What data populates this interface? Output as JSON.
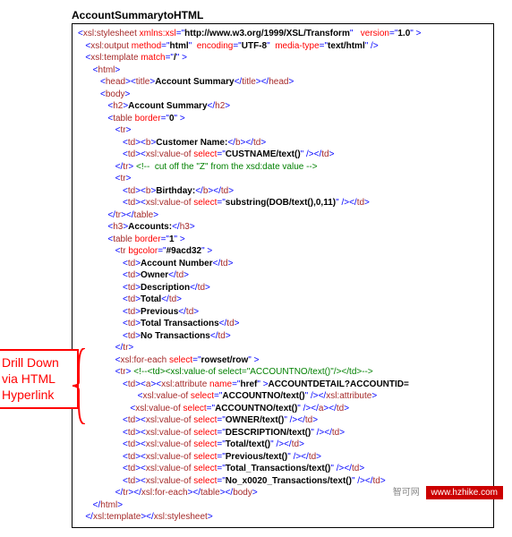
{
  "title": "AccountSummarytoHTML",
  "annotation": "Drill Down via HTML Hyperlink",
  "watermark": {
    "cn": "智可网",
    "url": "www.hzhike.com"
  },
  "tokens": {
    "l01": [
      [
        "<",
        "t-blue"
      ],
      [
        "xsl:stylesheet",
        "t-brown"
      ],
      [
        " xmlns:xsl",
        "t-red"
      ],
      [
        "=\"",
        "t-blue"
      ],
      [
        "http://www.w3.org/1999/XSL/Transform",
        "t-black"
      ],
      [
        "\"   ",
        "t-blue"
      ],
      [
        "version",
        "t-red"
      ],
      [
        "=\"",
        "t-blue"
      ],
      [
        "1.0",
        "t-black"
      ],
      [
        "\" >",
        "t-blue"
      ]
    ],
    "l02": [
      [
        "   <",
        "t-blue"
      ],
      [
        "xsl:output",
        "t-brown"
      ],
      [
        " method",
        "t-red"
      ],
      [
        "=\"",
        "t-blue"
      ],
      [
        "html",
        "t-black"
      ],
      [
        "\"  ",
        "t-blue"
      ],
      [
        "encoding",
        "t-red"
      ],
      [
        "=\"",
        "t-blue"
      ],
      [
        "UTF-8",
        "t-black"
      ],
      [
        "\"  ",
        "t-blue"
      ],
      [
        "media-type",
        "t-red"
      ],
      [
        "=\"",
        "t-blue"
      ],
      [
        "text/html",
        "t-black"
      ],
      [
        "\" />",
        "t-blue"
      ]
    ],
    "l03": [
      [
        "   <",
        "t-blue"
      ],
      [
        "xsl:template",
        "t-brown"
      ],
      [
        " match",
        "t-red"
      ],
      [
        "=\"",
        "t-blue"
      ],
      [
        "/",
        "t-black"
      ],
      [
        "\" >",
        "t-blue"
      ]
    ],
    "l04": [
      [
        "      <",
        "t-blue"
      ],
      [
        "html",
        "t-brown"
      ],
      [
        ">",
        "t-blue"
      ]
    ],
    "l05": [
      [
        "         <",
        "t-blue"
      ],
      [
        "head",
        "t-brown"
      ],
      [
        "><",
        "t-blue"
      ],
      [
        "title",
        "t-brown"
      ],
      [
        ">",
        "t-blue"
      ],
      [
        "Account Summary",
        "t-black"
      ],
      [
        "</",
        "t-blue"
      ],
      [
        "title",
        "t-brown"
      ],
      [
        "></",
        "t-blue"
      ],
      [
        "head",
        "t-brown"
      ],
      [
        ">",
        "t-blue"
      ]
    ],
    "l06": [
      [
        "         <",
        "t-blue"
      ],
      [
        "body",
        "t-brown"
      ],
      [
        ">",
        "t-blue"
      ]
    ],
    "l07": [
      [
        "            <",
        "t-blue"
      ],
      [
        "h2",
        "t-brown"
      ],
      [
        ">",
        "t-blue"
      ],
      [
        "Account Summary",
        "t-black"
      ],
      [
        "</",
        "t-blue"
      ],
      [
        "h2",
        "t-brown"
      ],
      [
        ">",
        "t-blue"
      ]
    ],
    "l08": [
      [
        "            <",
        "t-blue"
      ],
      [
        "table",
        "t-brown"
      ],
      [
        " border",
        "t-red"
      ],
      [
        "=\"",
        "t-blue"
      ],
      [
        "0",
        "t-black"
      ],
      [
        "\" >",
        "t-blue"
      ]
    ],
    "l09": [
      [
        "               <",
        "t-blue"
      ],
      [
        "tr",
        "t-brown"
      ],
      [
        ">",
        "t-blue"
      ]
    ],
    "l10": [
      [
        "                  <",
        "t-blue"
      ],
      [
        "td",
        "t-brown"
      ],
      [
        "><",
        "t-blue"
      ],
      [
        "b",
        "t-brown"
      ],
      [
        ">",
        "t-blue"
      ],
      [
        "Customer Name:",
        "t-black"
      ],
      [
        "</",
        "t-blue"
      ],
      [
        "b",
        "t-brown"
      ],
      [
        "></",
        "t-blue"
      ],
      [
        "td",
        "t-brown"
      ],
      [
        ">",
        "t-blue"
      ]
    ],
    "l11": [
      [
        "                  <",
        "t-blue"
      ],
      [
        "td",
        "t-brown"
      ],
      [
        "><",
        "t-blue"
      ],
      [
        "xsl:value-of",
        "t-brown"
      ],
      [
        " select",
        "t-red"
      ],
      [
        "=\"",
        "t-blue"
      ],
      [
        "CUSTNAME/text()",
        "t-black"
      ],
      [
        "\" /></",
        "t-blue"
      ],
      [
        "td",
        "t-brown"
      ],
      [
        ">",
        "t-blue"
      ]
    ],
    "l12": [
      [
        "               </",
        "t-blue"
      ],
      [
        "tr",
        "t-brown"
      ],
      [
        "> ",
        "t-blue"
      ],
      [
        "<!--  cut off the \"Z\" from the xsd:date value -->",
        "t-green"
      ]
    ],
    "l13": [
      [
        "               <",
        "t-blue"
      ],
      [
        "tr",
        "t-brown"
      ],
      [
        ">",
        "t-blue"
      ]
    ],
    "l14": [
      [
        "                  <",
        "t-blue"
      ],
      [
        "td",
        "t-brown"
      ],
      [
        "><",
        "t-blue"
      ],
      [
        "b",
        "t-brown"
      ],
      [
        ">",
        "t-blue"
      ],
      [
        "Birthday:",
        "t-black"
      ],
      [
        "</",
        "t-blue"
      ],
      [
        "b",
        "t-brown"
      ],
      [
        "></",
        "t-blue"
      ],
      [
        "td",
        "t-brown"
      ],
      [
        ">",
        "t-blue"
      ]
    ],
    "l15": [
      [
        "                  <",
        "t-blue"
      ],
      [
        "td",
        "t-brown"
      ],
      [
        "><",
        "t-blue"
      ],
      [
        "xsl:value-of",
        "t-brown"
      ],
      [
        " select",
        "t-red"
      ],
      [
        "=\"",
        "t-blue"
      ],
      [
        "substring(DOB/text(),0,11)",
        "t-black"
      ],
      [
        "\" /></",
        "t-blue"
      ],
      [
        "td",
        "t-brown"
      ],
      [
        ">",
        "t-blue"
      ]
    ],
    "l16": [
      [
        "            </",
        "t-blue"
      ],
      [
        "tr",
        "t-brown"
      ],
      [
        "></",
        "t-blue"
      ],
      [
        "table",
        "t-brown"
      ],
      [
        ">",
        "t-blue"
      ]
    ],
    "l17": [
      [
        "            <",
        "t-blue"
      ],
      [
        "h3",
        "t-brown"
      ],
      [
        ">",
        "t-blue"
      ],
      [
        "Accounts:",
        "t-black"
      ],
      [
        "</",
        "t-blue"
      ],
      [
        "h3",
        "t-brown"
      ],
      [
        ">",
        "t-blue"
      ]
    ],
    "l18": [
      [
        "            <",
        "t-blue"
      ],
      [
        "table",
        "t-brown"
      ],
      [
        " border",
        "t-red"
      ],
      [
        "=\"",
        "t-blue"
      ],
      [
        "1",
        "t-black"
      ],
      [
        "\" >",
        "t-blue"
      ]
    ],
    "l19": [
      [
        "               <",
        "t-blue"
      ],
      [
        "tr",
        "t-brown"
      ],
      [
        " bgcolor",
        "t-red"
      ],
      [
        "=\"",
        "t-blue"
      ],
      [
        "#9acd32",
        "t-black"
      ],
      [
        "\" >",
        "t-blue"
      ]
    ],
    "l20": [
      [
        "                  <",
        "t-blue"
      ],
      [
        "td",
        "t-brown"
      ],
      [
        ">",
        "t-blue"
      ],
      [
        "Account Number",
        "t-black"
      ],
      [
        "</",
        "t-blue"
      ],
      [
        "td",
        "t-brown"
      ],
      [
        ">",
        "t-blue"
      ]
    ],
    "l21": [
      [
        "                  <",
        "t-blue"
      ],
      [
        "td",
        "t-brown"
      ],
      [
        ">",
        "t-blue"
      ],
      [
        "Owner",
        "t-black"
      ],
      [
        "</",
        "t-blue"
      ],
      [
        "td",
        "t-brown"
      ],
      [
        ">",
        "t-blue"
      ]
    ],
    "l22": [
      [
        "                  <",
        "t-blue"
      ],
      [
        "td",
        "t-brown"
      ],
      [
        ">",
        "t-blue"
      ],
      [
        "Description",
        "t-black"
      ],
      [
        "</",
        "t-blue"
      ],
      [
        "td",
        "t-brown"
      ],
      [
        ">",
        "t-blue"
      ]
    ],
    "l23": [
      [
        "                  <",
        "t-blue"
      ],
      [
        "td",
        "t-brown"
      ],
      [
        ">",
        "t-blue"
      ],
      [
        "Total",
        "t-black"
      ],
      [
        "</",
        "t-blue"
      ],
      [
        "td",
        "t-brown"
      ],
      [
        ">",
        "t-blue"
      ]
    ],
    "l24": [
      [
        "                  <",
        "t-blue"
      ],
      [
        "td",
        "t-brown"
      ],
      [
        ">",
        "t-blue"
      ],
      [
        "Previous",
        "t-black"
      ],
      [
        "</",
        "t-blue"
      ],
      [
        "td",
        "t-brown"
      ],
      [
        ">",
        "t-blue"
      ]
    ],
    "l25": [
      [
        "                  <",
        "t-blue"
      ],
      [
        "td",
        "t-brown"
      ],
      [
        ">",
        "t-blue"
      ],
      [
        "Total Transactions",
        "t-black"
      ],
      [
        "</",
        "t-blue"
      ],
      [
        "td",
        "t-brown"
      ],
      [
        ">",
        "t-blue"
      ]
    ],
    "l26": [
      [
        "                  <",
        "t-blue"
      ],
      [
        "td",
        "t-brown"
      ],
      [
        ">",
        "t-blue"
      ],
      [
        "No Transactions",
        "t-black"
      ],
      [
        "</",
        "t-blue"
      ],
      [
        "td",
        "t-brown"
      ],
      [
        ">",
        "t-blue"
      ]
    ],
    "l27": [
      [
        "               </",
        "t-blue"
      ],
      [
        "tr",
        "t-brown"
      ],
      [
        ">",
        "t-blue"
      ]
    ],
    "l28": [
      [
        "               <",
        "t-blue"
      ],
      [
        "xsl:for-each",
        "t-brown"
      ],
      [
        " select",
        "t-red"
      ],
      [
        "=\"",
        "t-blue"
      ],
      [
        "rowset/row",
        "t-black"
      ],
      [
        "\" >",
        "t-blue"
      ]
    ],
    "l29": [
      [
        "               <",
        "t-blue"
      ],
      [
        "tr",
        "t-brown"
      ],
      [
        "> ",
        "t-blue"
      ],
      [
        "<!--<td><xsl:value-of select=\"ACCOUNTNO/text()\"/></td>-->",
        "t-green"
      ]
    ],
    "l30": [
      [
        "                  <",
        "t-blue"
      ],
      [
        "td",
        "t-brown"
      ],
      [
        "><",
        "t-blue"
      ],
      [
        "a",
        "t-brown"
      ],
      [
        "><",
        "t-blue"
      ],
      [
        "xsl:attribute",
        "t-brown"
      ],
      [
        " name",
        "t-red"
      ],
      [
        "=\"",
        "t-blue"
      ],
      [
        "href",
        "t-black"
      ],
      [
        "\" >",
        "t-blue"
      ],
      [
        "ACCOUNTDETAIL?ACCOUNTID=",
        "t-black"
      ]
    ],
    "l31": [
      [
        "                        <",
        "t-blue"
      ],
      [
        "xsl:value-of",
        "t-brown"
      ],
      [
        " select",
        "t-red"
      ],
      [
        "=\"",
        "t-blue"
      ],
      [
        "ACCOUNTNO/text()",
        "t-black"
      ],
      [
        "\" /></",
        "t-blue"
      ],
      [
        "xsl:attribute",
        "t-brown"
      ],
      [
        ">",
        "t-blue"
      ]
    ],
    "l32": [
      [
        "                     <",
        "t-blue"
      ],
      [
        "xsl:value-of",
        "t-brown"
      ],
      [
        " select",
        "t-red"
      ],
      [
        "=\"",
        "t-blue"
      ],
      [
        "ACCOUNTNO/text()",
        "t-black"
      ],
      [
        "\" /></",
        "t-blue"
      ],
      [
        "a",
        "t-brown"
      ],
      [
        "></",
        "t-blue"
      ],
      [
        "td",
        "t-brown"
      ],
      [
        ">",
        "t-blue"
      ]
    ],
    "l33": [
      [
        "                  <",
        "t-blue"
      ],
      [
        "td",
        "t-brown"
      ],
      [
        "><",
        "t-blue"
      ],
      [
        "xsl:value-of",
        "t-brown"
      ],
      [
        " select",
        "t-red"
      ],
      [
        "=\"",
        "t-blue"
      ],
      [
        "OWNER/text()",
        "t-black"
      ],
      [
        "\" /></",
        "t-blue"
      ],
      [
        "td",
        "t-brown"
      ],
      [
        ">",
        "t-blue"
      ]
    ],
    "l34": [
      [
        "                  <",
        "t-blue"
      ],
      [
        "td",
        "t-brown"
      ],
      [
        "><",
        "t-blue"
      ],
      [
        "xsl:value-of",
        "t-brown"
      ],
      [
        " select",
        "t-red"
      ],
      [
        "=\"",
        "t-blue"
      ],
      [
        "DESCRIPTION/text()",
        "t-black"
      ],
      [
        "\" /></",
        "t-blue"
      ],
      [
        "td",
        "t-brown"
      ],
      [
        ">",
        "t-blue"
      ]
    ],
    "l35": [
      [
        "                  <",
        "t-blue"
      ],
      [
        "td",
        "t-brown"
      ],
      [
        "><",
        "t-blue"
      ],
      [
        "xsl:value-of",
        "t-brown"
      ],
      [
        " select",
        "t-red"
      ],
      [
        "=\"",
        "t-blue"
      ],
      [
        "Total/text()",
        "t-black"
      ],
      [
        "\" /></",
        "t-blue"
      ],
      [
        "td",
        "t-brown"
      ],
      [
        ">",
        "t-blue"
      ]
    ],
    "l36": [
      [
        "                  <",
        "t-blue"
      ],
      [
        "td",
        "t-brown"
      ],
      [
        "><",
        "t-blue"
      ],
      [
        "xsl:value-of",
        "t-brown"
      ],
      [
        " select",
        "t-red"
      ],
      [
        "=\"",
        "t-blue"
      ],
      [
        "Previous/text()",
        "t-black"
      ],
      [
        "\" /></",
        "t-blue"
      ],
      [
        "td",
        "t-brown"
      ],
      [
        ">",
        "t-blue"
      ]
    ],
    "l37": [
      [
        "                  <",
        "t-blue"
      ],
      [
        "td",
        "t-brown"
      ],
      [
        "><",
        "t-blue"
      ],
      [
        "xsl:value-of",
        "t-brown"
      ],
      [
        " select",
        "t-red"
      ],
      [
        "=\"",
        "t-blue"
      ],
      [
        "Total_Transactions/text()",
        "t-black"
      ],
      [
        "\" /></",
        "t-blue"
      ],
      [
        "td",
        "t-brown"
      ],
      [
        ">",
        "t-blue"
      ]
    ],
    "l38": [
      [
        "                  <",
        "t-blue"
      ],
      [
        "td",
        "t-brown"
      ],
      [
        "><",
        "t-blue"
      ],
      [
        "xsl:value-of",
        "t-brown"
      ],
      [
        " select",
        "t-red"
      ],
      [
        "=\"",
        "t-blue"
      ],
      [
        "No_x0020_Transactions/text()",
        "t-black"
      ],
      [
        "\" /></",
        "t-blue"
      ],
      [
        "td",
        "t-brown"
      ],
      [
        ">",
        "t-blue"
      ]
    ],
    "l39": [
      [
        "               </",
        "t-blue"
      ],
      [
        "tr",
        "t-brown"
      ],
      [
        "></",
        "t-blue"
      ],
      [
        "xsl:for-each",
        "t-brown"
      ],
      [
        "></",
        "t-blue"
      ],
      [
        "table",
        "t-brown"
      ],
      [
        "></",
        "t-blue"
      ],
      [
        "body",
        "t-brown"
      ],
      [
        ">",
        "t-blue"
      ]
    ],
    "l40": [
      [
        "      </",
        "t-blue"
      ],
      [
        "html",
        "t-brown"
      ],
      [
        ">",
        "t-blue"
      ]
    ],
    "l41": [
      [
        "   </",
        "t-blue"
      ],
      [
        "xsl:template",
        "t-brown"
      ],
      [
        "></",
        "t-blue"
      ],
      [
        "xsl:stylesheet",
        "t-brown"
      ],
      [
        ">",
        "t-blue"
      ]
    ]
  },
  "lineOrder": [
    "l01",
    "l02",
    "l03",
    "l04",
    "l05",
    "l06",
    "l07",
    "l08",
    "l09",
    "l10",
    "l11",
    "l12",
    "l13",
    "l14",
    "l15",
    "l16",
    "l17",
    "l18",
    "l19",
    "l20",
    "l21",
    "l22",
    "l23",
    "l24",
    "l25",
    "l26",
    "l27",
    "l28",
    "l29",
    "l30",
    "l31",
    "l32",
    "l33",
    "l34",
    "l35",
    "l36",
    "l37",
    "l38",
    "l39",
    "l40",
    "l41"
  ]
}
